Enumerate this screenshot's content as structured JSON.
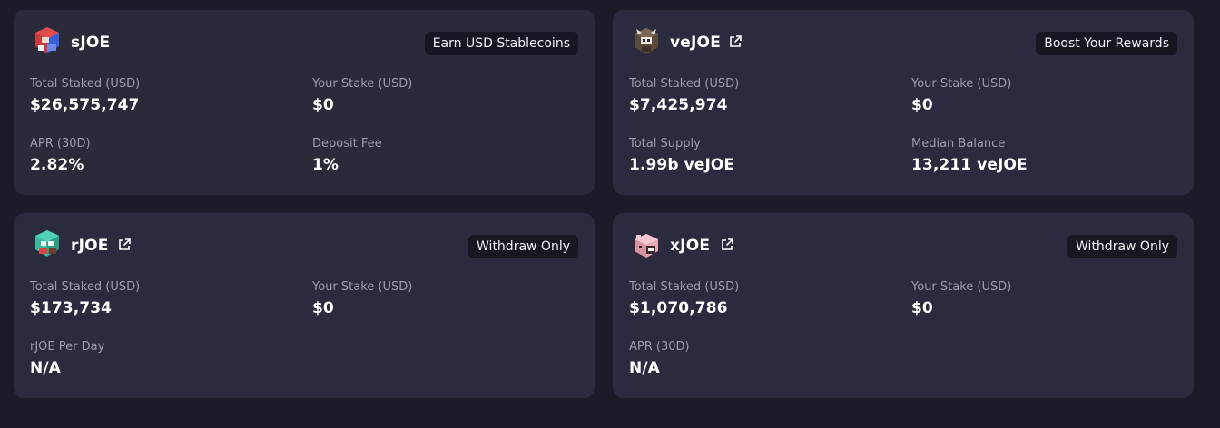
{
  "cards": {
    "sjoe": {
      "name": "sJOE",
      "pill": "Earn USD Stablecoins",
      "stats": [
        {
          "label": "Total Staked (USD)",
          "value": "$26,575,747"
        },
        {
          "label": "Your Stake (USD)",
          "value": "$0"
        },
        {
          "label": "APR (30D)",
          "value": "2.82%"
        },
        {
          "label": "Deposit Fee",
          "value": "1%"
        }
      ]
    },
    "vejoe": {
      "name": "veJOE",
      "pill": "Boost Your Rewards",
      "stats": [
        {
          "label": "Total Staked (USD)",
          "value": "$7,425,974"
        },
        {
          "label": "Your Stake (USD)",
          "value": "$0"
        },
        {
          "label": "Total Supply",
          "value": "1.99b veJOE"
        },
        {
          "label": "Median Balance",
          "value": "13,211 veJOE"
        }
      ]
    },
    "rjoe": {
      "name": "rJOE",
      "pill": "Withdraw Only",
      "stats": [
        {
          "label": "Total Staked (USD)",
          "value": "$173,734"
        },
        {
          "label": "Your Stake (USD)",
          "value": "$0"
        },
        {
          "label": "rJOE Per Day",
          "value": "N/A"
        }
      ]
    },
    "xjoe": {
      "name": "xJOE",
      "pill": "Withdraw Only",
      "stats": [
        {
          "label": "Total Staked (USD)",
          "value": "$1,070,786"
        },
        {
          "label": "Your Stake (USD)",
          "value": "$0"
        },
        {
          "label": "APR (30D)",
          "value": "N/A"
        }
      ]
    }
  },
  "icons": {
    "external_link": "external-link-icon"
  },
  "colors": {
    "page_bg": "#1b1b29",
    "card_bg": "#2b2b3f",
    "pill_bg": "#171722",
    "label": "#9d9daf",
    "value": "#ffffff"
  }
}
